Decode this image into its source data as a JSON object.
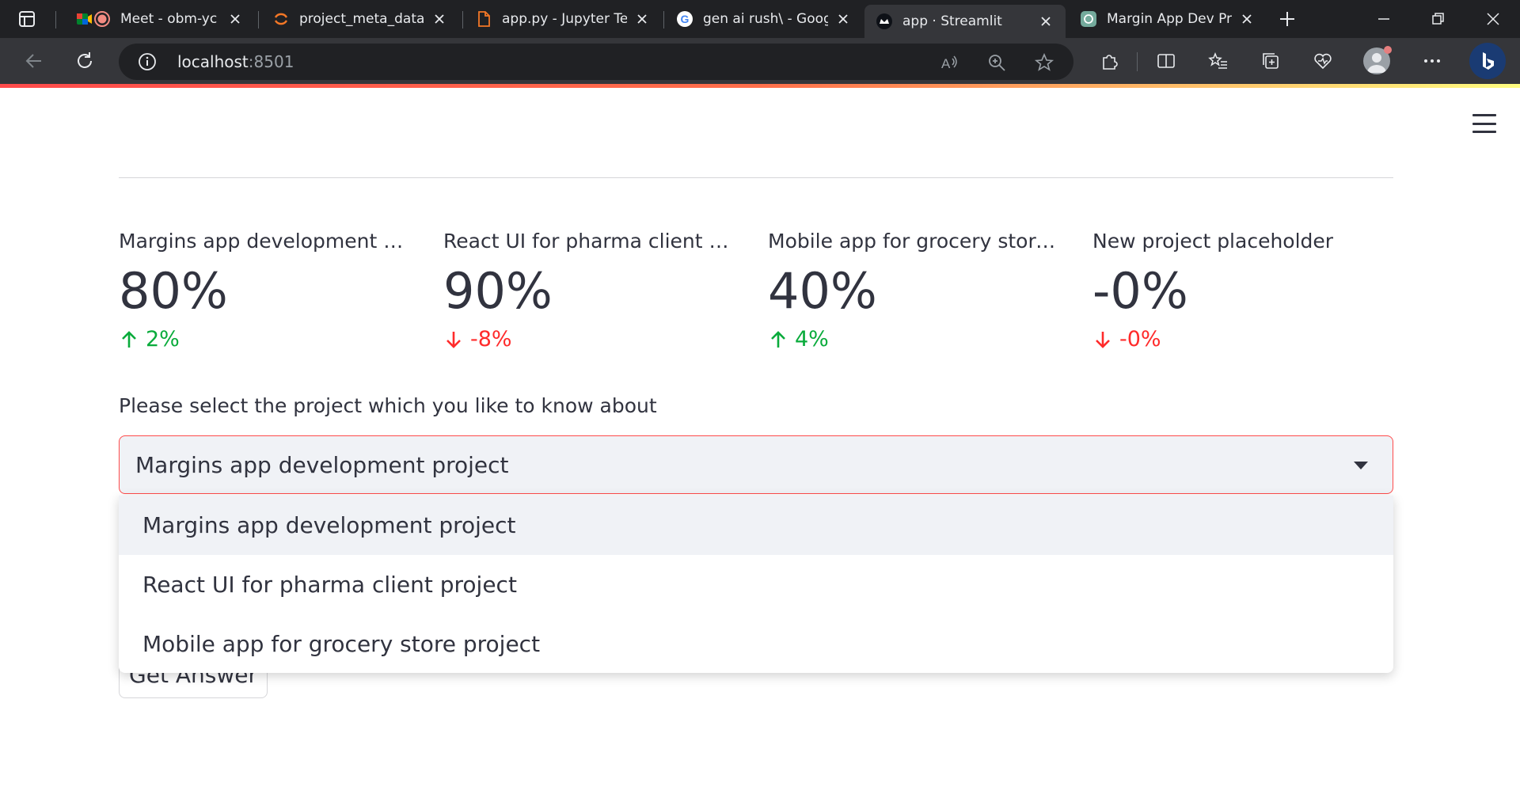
{
  "browser": {
    "tabs": [
      {
        "title": "Meet - obm-yc",
        "favicon": "google-meet-icon"
      },
      {
        "title": "project_meta_data/",
        "favicon": "jupyter-icon"
      },
      {
        "title": "app.py - Jupyter Tex",
        "favicon": "file-icon"
      },
      {
        "title": "gen ai rush\\ - Goog",
        "favicon": "google-icon"
      },
      {
        "title": "app · Streamlit",
        "favicon": "streamlit-icon",
        "active": true
      },
      {
        "title": "Margin App Dev Pro",
        "favicon": "chatgpt-icon"
      }
    ],
    "url_host": "localhost",
    "url_port": ":8501"
  },
  "metrics": [
    {
      "label": "Margins app development project",
      "value": "80%",
      "delta": "2%",
      "direction": "up"
    },
    {
      "label": "React UI for pharma client project",
      "value": "90%",
      "delta": "-8%",
      "direction": "down"
    },
    {
      "label": "Mobile app for grocery store proj…",
      "value": "40%",
      "delta": "4%",
      "direction": "up"
    },
    {
      "label": "New project placeholder",
      "value": "-0%",
      "delta": "-0%",
      "direction": "down"
    }
  ],
  "select": {
    "label": "Please select the project which you like to know about",
    "value": "Margins app development project",
    "options": [
      "Margins app development project",
      "React UI for pharma client project",
      "Mobile app for grocery store project"
    ]
  },
  "button": {
    "label": "Get Answer"
  },
  "colors": {
    "accent": "#ff4b4b",
    "up": "#09ab3b",
    "down": "#ff2b2b"
  }
}
